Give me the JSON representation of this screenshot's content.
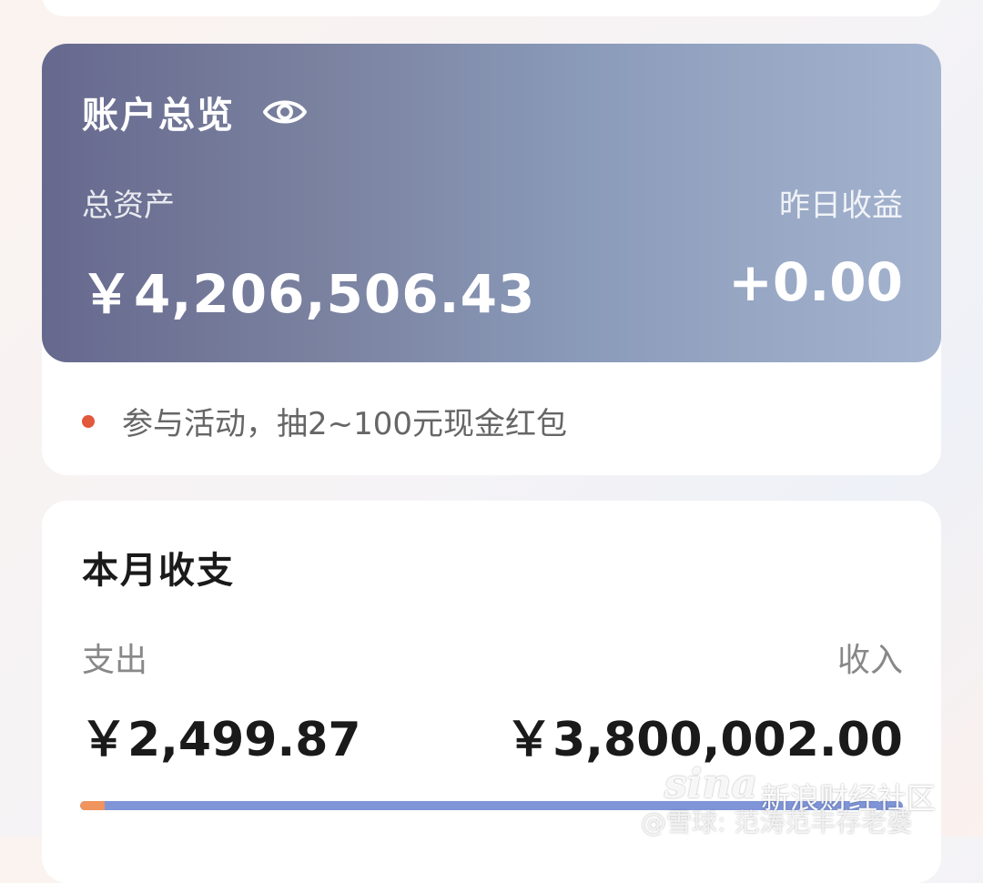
{
  "overview": {
    "title": "账户总览",
    "total_assets_label": "总资产",
    "total_assets_value": "￥4,206,506.43",
    "yesterday_income_label": "昨日收益",
    "yesterday_income_value": "+0.00",
    "visibility_icon": "eye-icon"
  },
  "promo": {
    "text": "参与活动，抽2~100元现金红包",
    "dot_color": "#e2583a"
  },
  "monthly": {
    "title": "本月收支",
    "expense_label": "支出",
    "expense_value": "￥2,499.87",
    "income_label": "收入",
    "income_value": "￥3,800,002.00",
    "expense_share": 0.03,
    "expense_color": "#f0935c",
    "income_color": "#7f95d8"
  },
  "watermark": {
    "logo": "sina",
    "site": "新浪财经社区",
    "author": "@雪球: 范涛范丰存老婆"
  }
}
